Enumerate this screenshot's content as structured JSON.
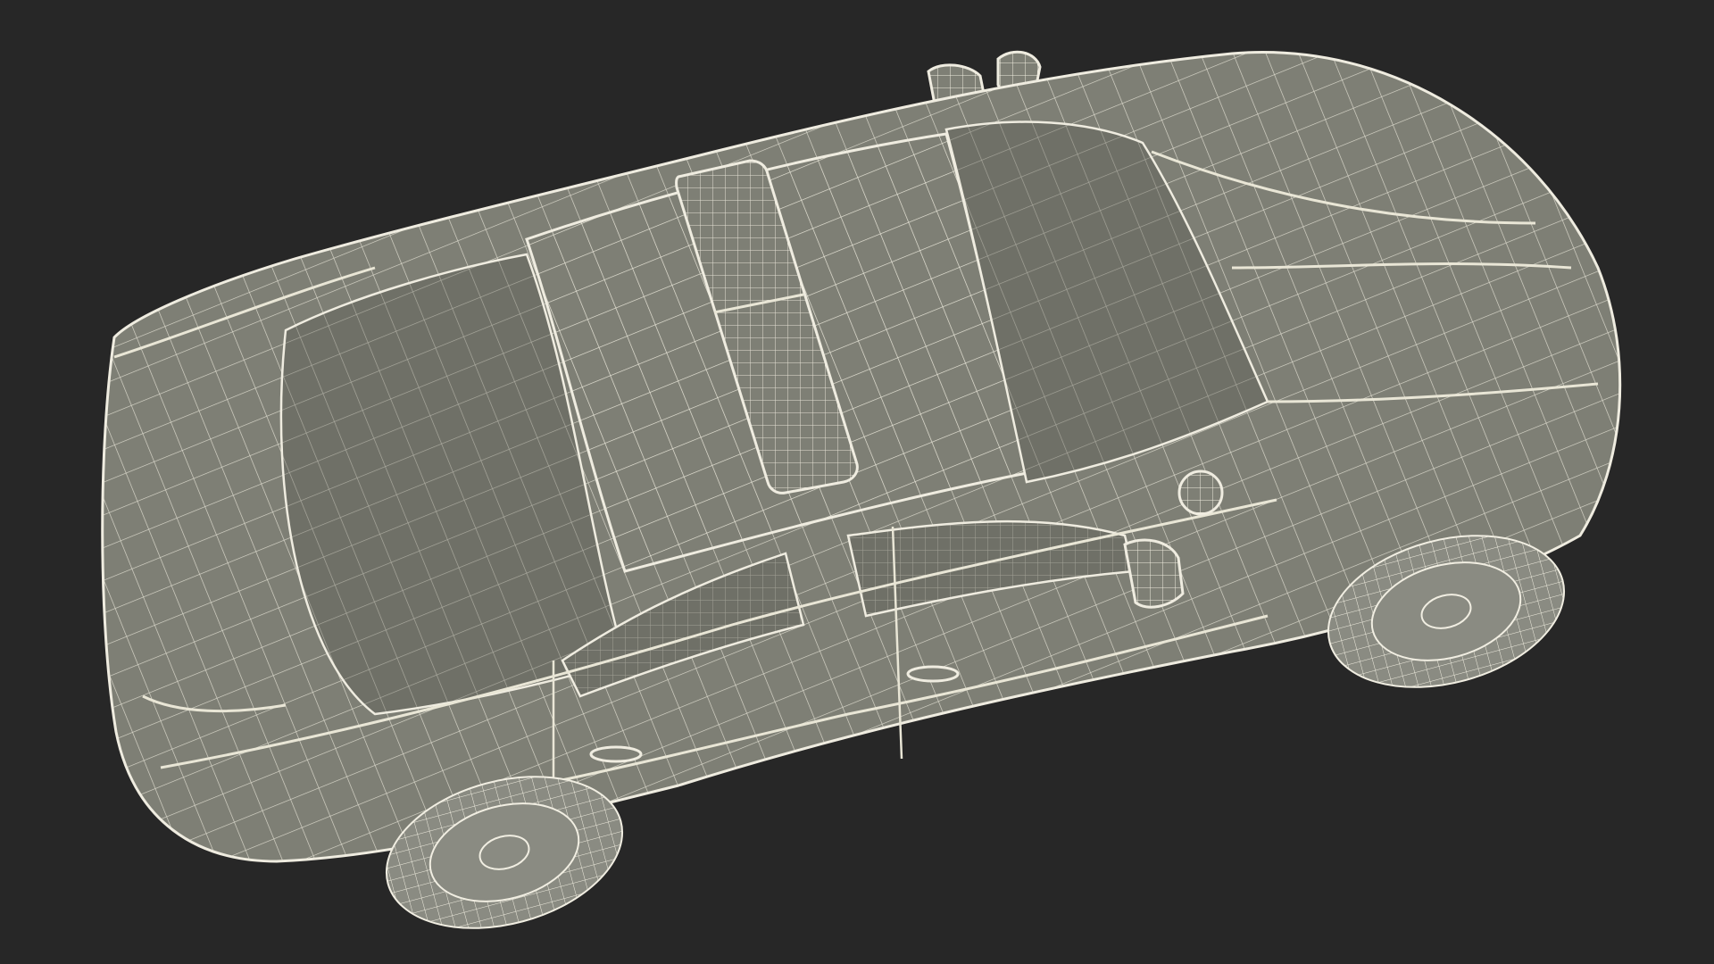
{
  "scene": {
    "background_color": "#272727",
    "model_fill_color": "#7e7f75",
    "wire_color": "#e9e6d6",
    "subject": "car-wireframe"
  }
}
